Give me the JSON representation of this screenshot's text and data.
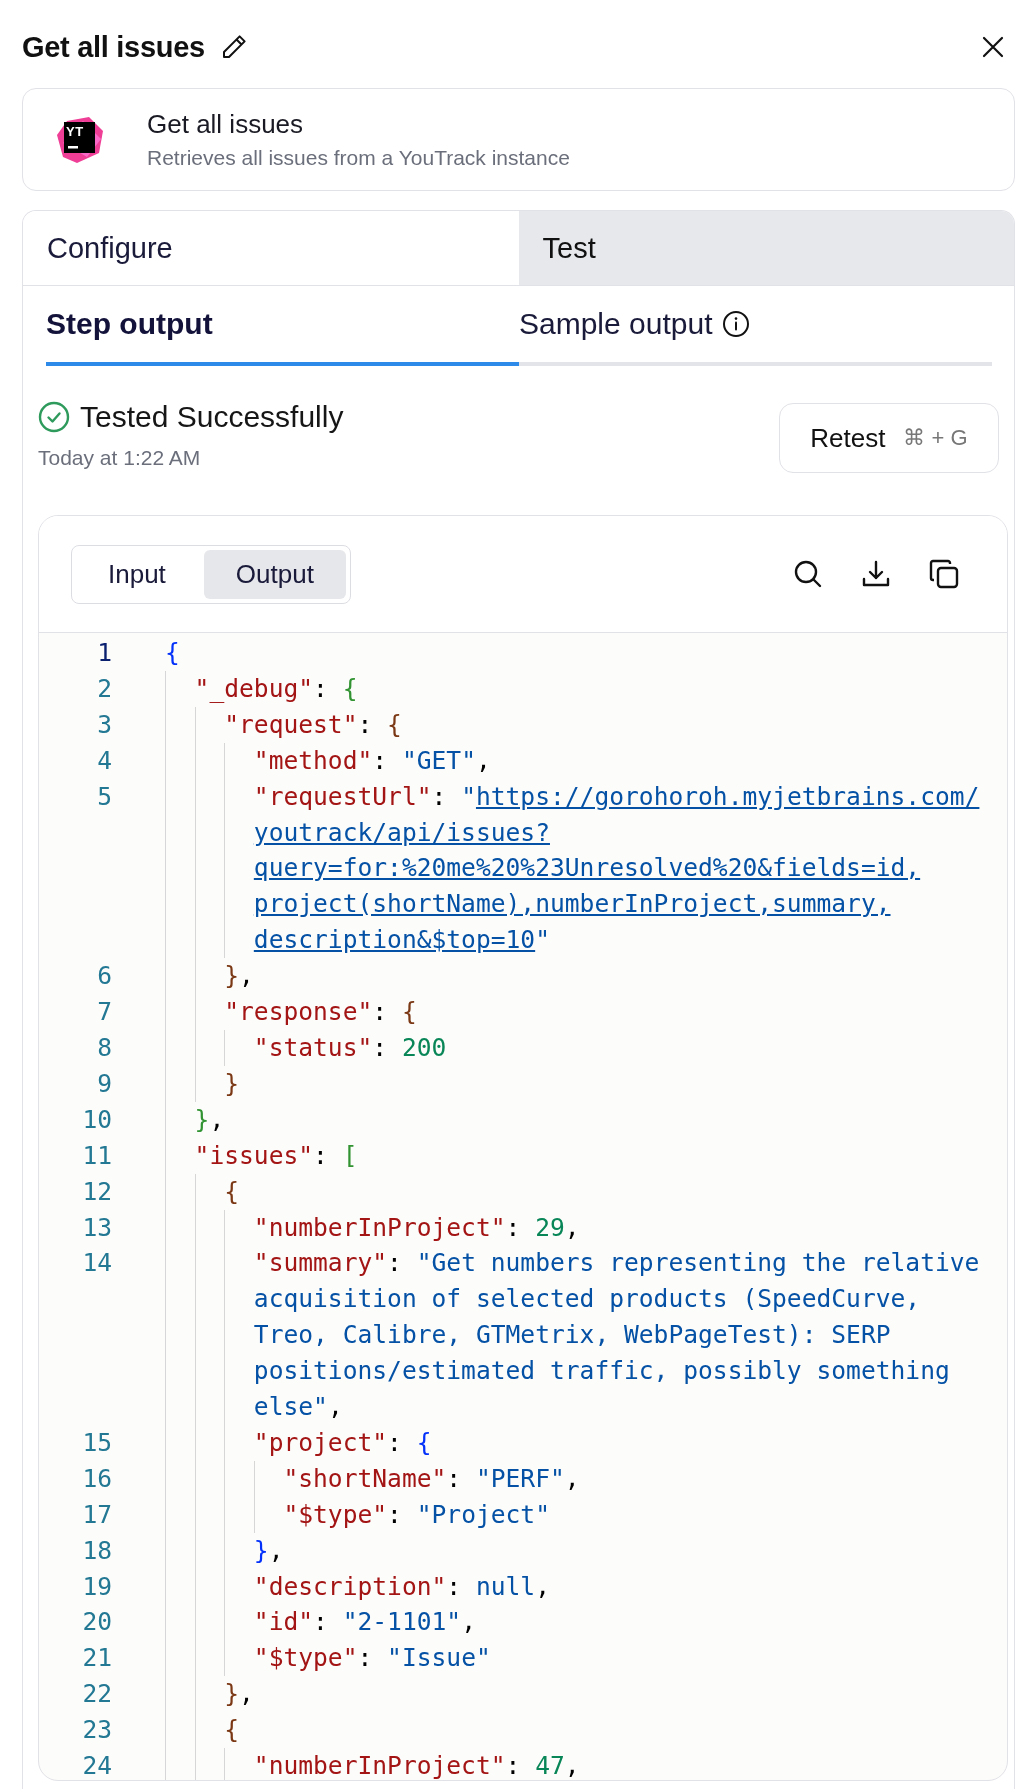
{
  "title": "Get all issues",
  "app": {
    "logo_text": "YT",
    "name": "Get all issues",
    "description": "Retrieves all issues from a YouTrack instance"
  },
  "tabs": [
    {
      "label": "Configure",
      "selected": false
    },
    {
      "label": "Test",
      "selected": true
    }
  ],
  "subtabs": [
    {
      "label": "Step output",
      "selected": true,
      "info": false
    },
    {
      "label": "Sample output",
      "selected": false,
      "info": true
    }
  ],
  "status": {
    "text": "Tested Successfully",
    "time": "Today at 1:22 AM",
    "success": true
  },
  "retest": {
    "label": "Retest",
    "shortcut": "⌘ + G"
  },
  "output": {
    "toggle": [
      {
        "label": "Input",
        "selected": false
      },
      {
        "label": "Output",
        "selected": true
      }
    ],
    "lines": [
      {
        "number": "1",
        "active": true,
        "link": false,
        "rows": [
          "{"
        ]
      },
      {
        "number": "2",
        "active": false,
        "link": false,
        "rows": [
          "  \"_debug\": {"
        ]
      },
      {
        "number": "3",
        "active": false,
        "link": false,
        "rows": [
          "    \"request\": {"
        ]
      },
      {
        "number": "4",
        "active": false,
        "link": false,
        "rows": [
          "      \"method\": \"GET\","
        ]
      },
      {
        "number": "5",
        "active": false,
        "link": true,
        "rows": [
          "      \"requestUrl\": \"https://gorohoroh.myjetbrains.com/",
          "youtrack/api/issues?",
          "query=for:%20me%20%23Unresolved%20&fields=id,",
          "project(shortName),numberInProject,summary,",
          "description&$top=10\""
        ]
      },
      {
        "number": "6",
        "active": false,
        "link": false,
        "rows": [
          "    },"
        ]
      },
      {
        "number": "7",
        "active": false,
        "link": false,
        "rows": [
          "    \"response\": {"
        ]
      },
      {
        "number": "8",
        "active": false,
        "link": false,
        "rows": [
          "      \"status\": 200"
        ]
      },
      {
        "number": "9",
        "active": false,
        "link": false,
        "rows": [
          "    }"
        ]
      },
      {
        "number": "10",
        "active": false,
        "link": false,
        "rows": [
          "  },"
        ]
      },
      {
        "number": "11",
        "active": false,
        "link": false,
        "rows": [
          "  \"issues\": ["
        ]
      },
      {
        "number": "12",
        "active": false,
        "link": false,
        "rows": [
          "    {"
        ]
      },
      {
        "number": "13",
        "active": false,
        "link": false,
        "rows": [
          "      \"numberInProject\": 29,"
        ]
      },
      {
        "number": "14",
        "active": false,
        "link": false,
        "rows": [
          "      \"summary\": \"Get numbers representing the relative",
          "acquisition of selected products (SpeedCurve,",
          "Treo, Calibre, GTMetrix, WebPageTest): SERP",
          "positions/estimated traffic, possibly something",
          "else\","
        ]
      },
      {
        "number": "15",
        "active": false,
        "link": false,
        "rows": [
          "      \"project\": {"
        ]
      },
      {
        "number": "16",
        "active": false,
        "link": false,
        "rows": [
          "        \"shortName\": \"PERF\","
        ]
      },
      {
        "number": "17",
        "active": false,
        "link": false,
        "rows": [
          "        \"$type\": \"Project\""
        ]
      },
      {
        "number": "18",
        "active": false,
        "link": false,
        "rows": [
          "      },"
        ]
      },
      {
        "number": "19",
        "active": false,
        "link": false,
        "rows": [
          "      \"description\": null,"
        ]
      },
      {
        "number": "20",
        "active": false,
        "link": false,
        "rows": [
          "      \"id\": \"2-1101\","
        ]
      },
      {
        "number": "21",
        "active": false,
        "link": false,
        "rows": [
          "      \"$type\": \"Issue\""
        ]
      },
      {
        "number": "22",
        "active": false,
        "link": false,
        "rows": [
          "    },"
        ]
      },
      {
        "number": "23",
        "active": false,
        "link": false,
        "rows": [
          "    {"
        ]
      },
      {
        "number": "24",
        "active": false,
        "link": false,
        "rows": [
          "      \"numberInProject\": 47,"
        ]
      }
    ]
  }
}
